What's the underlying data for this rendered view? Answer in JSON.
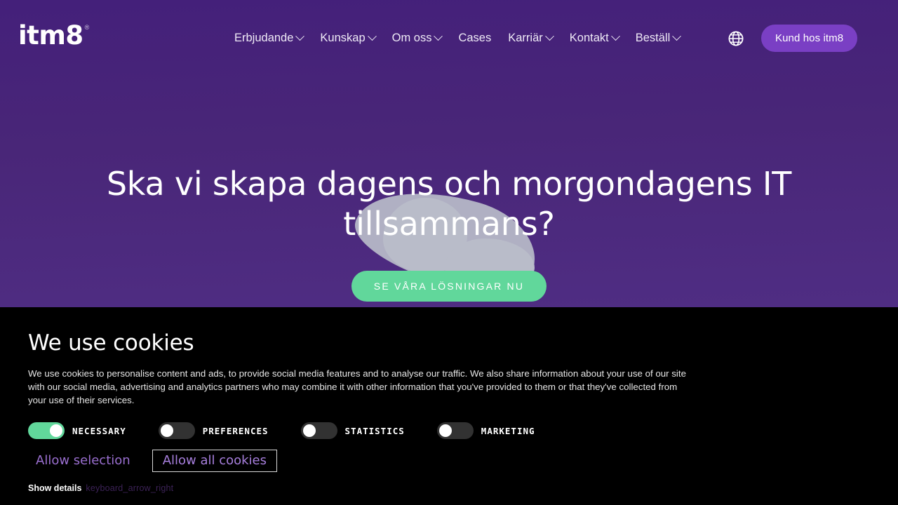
{
  "header": {
    "logo": {
      "text": "itm8",
      "registered_mark": "®",
      "icon": "itm8-logo"
    },
    "nav_items": [
      {
        "label": "Erbjudande",
        "has_dropdown": true
      },
      {
        "label": "Kunskap",
        "has_dropdown": true
      },
      {
        "label": "Om oss",
        "has_dropdown": true
      },
      {
        "label": "Cases",
        "has_dropdown": false
      },
      {
        "label": "Karriär",
        "has_dropdown": true
      },
      {
        "label": "Kontakt",
        "has_dropdown": true
      },
      {
        "label": "Beställ",
        "has_dropdown": true
      }
    ],
    "language_icon": "globe-icon",
    "cta_label": "Kund hos itm8",
    "cta_color": "#7a3fc4"
  },
  "hero": {
    "title": "Ska vi skapa dagens och morgondagens IT tillsammans?",
    "button_label": "SE VÅRA LÖSNINGAR NU",
    "button_color": "#61d79b",
    "background_color": "#4b2880",
    "decoration": "gray-blob-shape"
  },
  "cookie_banner": {
    "background_color": "#000000",
    "title": "We use cookies",
    "body": "We use cookies to personalise content and ads, to provide social media features and to analyse our traffic. We also share information about your use of our site with our social media, advertising and analytics partners who may combine it with other information that you've provided to them or that they've collected from your use of their services.",
    "toggles": [
      {
        "label": "NECESSARY",
        "state": "on"
      },
      {
        "label": "PREFERENCES",
        "state": "off"
      },
      {
        "label": "STATISTICS",
        "state": "off"
      },
      {
        "label": "MARKETING",
        "state": "off"
      }
    ],
    "allow_selection_label": "Allow selection",
    "allow_all_label": "Allow all cookies",
    "show_details_label": "Show details",
    "show_details_icon_text": "keyboard_arrow_right",
    "accent_color": "#9a6fd0",
    "toggle_on_color": "#61d79b"
  }
}
